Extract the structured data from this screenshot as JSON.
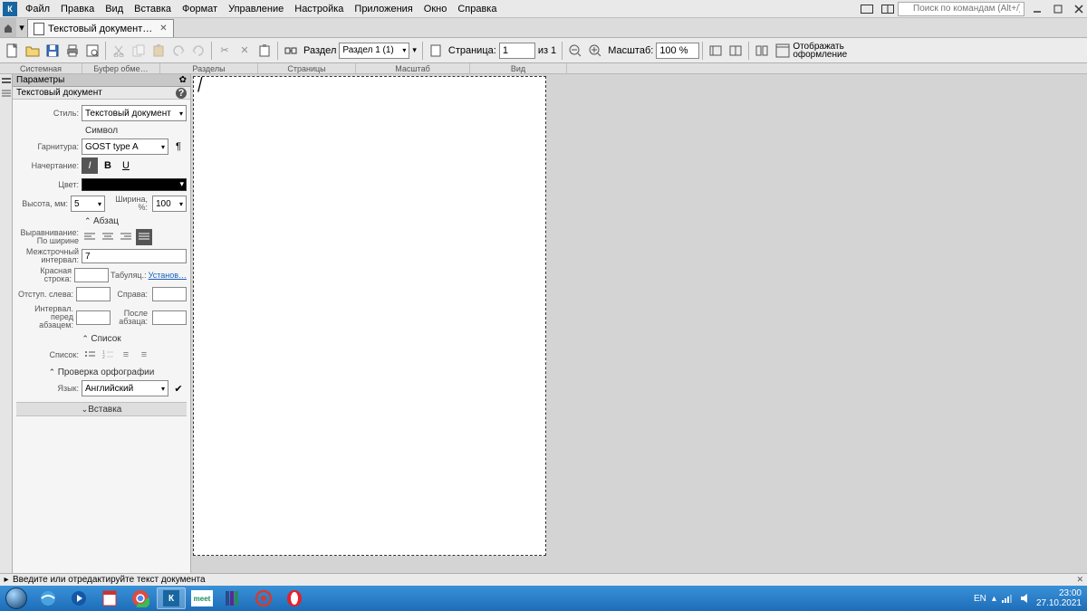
{
  "menubar": {
    "items": [
      "Файл",
      "Правка",
      "Вид",
      "Вставка",
      "Формат",
      "Управление",
      "Настройка",
      "Приложения",
      "Окно",
      "Справка"
    ],
    "search_placeholder": "Поиск по командам (Alt+/)"
  },
  "tabs": {
    "doc_title": "Текстовый документ…"
  },
  "toolbar": {
    "section_label": "Раздел",
    "section_value": "Раздел 1 (1)",
    "page_label": "Страница:",
    "page_value": "1",
    "page_of_label": "из 1",
    "zoom_label": "Масштаб:",
    "zoom_value": "100 %",
    "layout_label_1": "Отображать",
    "layout_label_2": "оформление"
  },
  "subrow": {
    "system": "Системная",
    "clipboard": "Буфер обме…",
    "sections": "Разделы",
    "pages": "Страницы",
    "scale": "Масштаб",
    "view": "Вид"
  },
  "sidebar": {
    "header": "Параметры",
    "subheader": "Текстовый документ",
    "style_label": "Стиль:",
    "style_value": "Текстовый документ",
    "symbol_title": "Символ",
    "font_label": "Гарнитура:",
    "font_value": "GOST type A",
    "face_label": "Начертание:",
    "color_label": "Цвет:",
    "height_label": "Высота, мм:",
    "height_value": "5",
    "width_label": "Ширина, %:",
    "width_value": "100",
    "para_title": "Абзац",
    "align_label_1": "Выравнивание:",
    "align_label_2": "По ширине",
    "linespace_label_1": "Межстрочный",
    "linespace_label_2": "интервал:",
    "linespace_value": "7",
    "firstline_label": "Красная строка:",
    "tab_label": "Табуляц.:",
    "tab_link": "Установ…",
    "indent_left_label": "Отступ. слева:",
    "indent_right_label": "Справа:",
    "space_before_label_1": "Интервал. перед",
    "space_before_label_2": "абзацем:",
    "space_after_label_1": "После",
    "space_after_label_2": "абзаца:",
    "list_title": "Список",
    "list_label": "Список:",
    "spell_title": "Проверка орфографии",
    "lang_label": "Язык:",
    "lang_value": "Английский",
    "insert_title": "Вставка"
  },
  "statusbar": {
    "text": "Введите или отредактируйте текст документа"
  },
  "taskbar": {
    "lang": "EN",
    "time": "23:00",
    "date": "27.10.2021"
  }
}
